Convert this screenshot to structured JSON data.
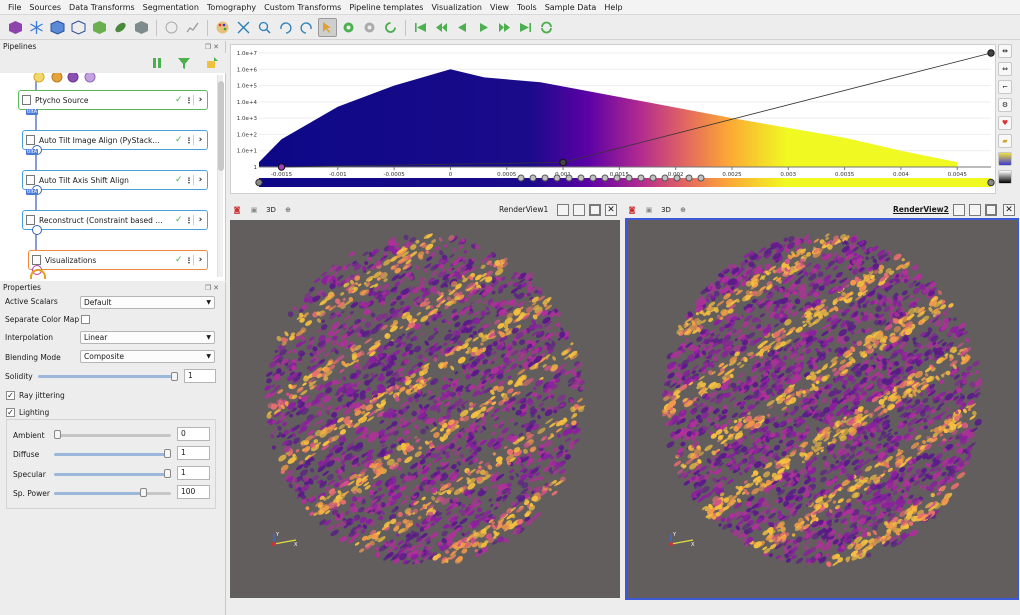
{
  "menu": [
    "File",
    "Sources",
    "Data Transforms",
    "Segmentation",
    "Tomography",
    "Custom Transforms",
    "Pipeline templates",
    "Visualization",
    "View",
    "Tools",
    "Sample Data",
    "Help"
  ],
  "toolbar": {
    "icons": [
      "cube-purple-icon",
      "snowflake-icon",
      "cube-blue-icon",
      "cube-outline-icon",
      "cube-green-icon",
      "leaf-icon",
      "cube-gray-icon",
      "tilt-icon",
      "chart-line-icon",
      "palette-icon",
      "fit-icon",
      "zoom-fit-icon",
      "rotate-plus-90-icon",
      "rotate-minus-90-icon",
      "select-icon",
      "gear-icon",
      "gear-gray-icon",
      "refresh-icon",
      "first-frame-icon",
      "prev-frame-icon",
      "reverse-play-icon",
      "play-icon",
      "next-frame-icon",
      "last-frame-icon",
      "loop-icon"
    ],
    "rot_plus": "+90",
    "rot_minus": "-90"
  },
  "pipelines": {
    "title": "Pipelines",
    "nodes": [
      {
        "label": "Ptycho Source",
        "color": "#5bb85c"
      },
      {
        "label": "Auto Tilt Image Align (PyStack...",
        "color": "#4b9fdc"
      },
      {
        "label": "Auto Tilt Axis Shift Align",
        "color": "#4b9fdc"
      },
      {
        "label": "Reconstruct (Constraint based ...",
        "color": "#4b9fdc"
      },
      {
        "label": "Visualizations",
        "color": "#f08a3c"
      }
    ],
    "tags": [
      "tiltA",
      "tiltA",
      "tiltA"
    ]
  },
  "properties": {
    "title": "Properties",
    "active_scalars_label": "Active Scalars",
    "active_scalars_value": "Default",
    "separate_cmap_label": "Separate Color Map",
    "interpolation_label": "Interpolation",
    "interpolation_value": "Linear",
    "blending_label": "Blending Mode",
    "blending_value": "Composite",
    "solidity_label": "Solidity",
    "solidity_value": "1",
    "ray_jitter_label": "Ray jittering",
    "lighting_label": "Lighting",
    "ambient_label": "Ambient",
    "ambient_value": "0",
    "diffuse_label": "Diffuse",
    "diffuse_value": "1",
    "specular_label": "Specular",
    "specular_value": "1",
    "sppower_label": "Sp. Power",
    "sppower_value": "100",
    "solidity_level": 1.0,
    "ambient_level": 0.0,
    "diffuse_level": 1.0,
    "specular_level": 1.0,
    "sppower_level": 0.78
  },
  "chart_data": {
    "type": "area",
    "title": "",
    "y_scale": "log",
    "y_ticks": [
      "1",
      "1.0e+1",
      "1.0e+2",
      "1.0e+3",
      "1.0e+4",
      "1.0e+5",
      "1.0e+6",
      "1.0e+7"
    ],
    "x_ticks": [
      "-0.0015",
      "-0.001",
      "-0.0005",
      "0",
      "0.0005",
      "0.001",
      "0.0015",
      "0.002",
      "0.0025",
      "0.003",
      "0.0035",
      "0.004",
      "0.0045"
    ],
    "xlim": [
      -0.0017,
      0.0048
    ],
    "ylim_log10": [
      0,
      7
    ],
    "x": [
      -0.0017,
      -0.0015,
      -0.001,
      -0.0005,
      0,
      0.0003,
      0.0008,
      0.0015,
      0.0025,
      0.0035,
      0.004,
      0.0045
    ],
    "y_log10": [
      0.3,
      1.7,
      3.7,
      5.0,
      6.0,
      5.5,
      5.2,
      4.3,
      3.0,
      1.8,
      1.0,
      0.3
    ],
    "opacity_line": [
      [
        -0.0015,
        0
      ],
      [
        0.001,
        0.04
      ],
      [
        0.0048,
        1.0
      ]
    ],
    "colormap": "plasma"
  },
  "render_views": [
    {
      "title": "RenderView1",
      "mode": "3D",
      "active": false
    },
    {
      "title": "RenderView2",
      "mode": "3D",
      "active": true
    }
  ],
  "axes_labels": {
    "x": "X",
    "y": "Y"
  }
}
